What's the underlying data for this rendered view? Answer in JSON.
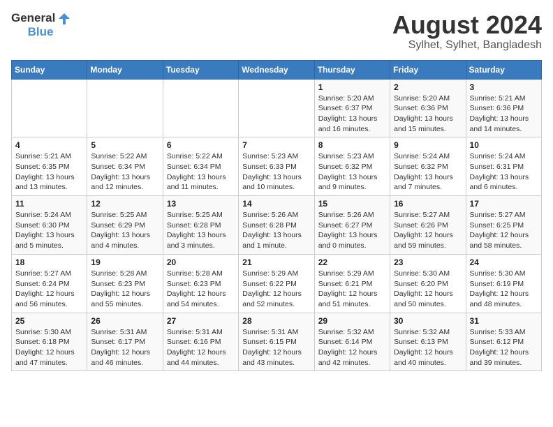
{
  "logo": {
    "line1": "General",
    "line2": "Blue"
  },
  "title": "August 2024",
  "subtitle": "Sylhet, Sylhet, Bangladesh",
  "days_of_week": [
    "Sunday",
    "Monday",
    "Tuesday",
    "Wednesday",
    "Thursday",
    "Friday",
    "Saturday"
  ],
  "weeks": [
    [
      {
        "day": "",
        "info": ""
      },
      {
        "day": "",
        "info": ""
      },
      {
        "day": "",
        "info": ""
      },
      {
        "day": "",
        "info": ""
      },
      {
        "day": "1",
        "info": "Sunrise: 5:20 AM\nSunset: 6:37 PM\nDaylight: 13 hours\nand 16 minutes."
      },
      {
        "day": "2",
        "info": "Sunrise: 5:20 AM\nSunset: 6:36 PM\nDaylight: 13 hours\nand 15 minutes."
      },
      {
        "day": "3",
        "info": "Sunrise: 5:21 AM\nSunset: 6:36 PM\nDaylight: 13 hours\nand 14 minutes."
      }
    ],
    [
      {
        "day": "4",
        "info": "Sunrise: 5:21 AM\nSunset: 6:35 PM\nDaylight: 13 hours\nand 13 minutes."
      },
      {
        "day": "5",
        "info": "Sunrise: 5:22 AM\nSunset: 6:34 PM\nDaylight: 13 hours\nand 12 minutes."
      },
      {
        "day": "6",
        "info": "Sunrise: 5:22 AM\nSunset: 6:34 PM\nDaylight: 13 hours\nand 11 minutes."
      },
      {
        "day": "7",
        "info": "Sunrise: 5:23 AM\nSunset: 6:33 PM\nDaylight: 13 hours\nand 10 minutes."
      },
      {
        "day": "8",
        "info": "Sunrise: 5:23 AM\nSunset: 6:32 PM\nDaylight: 13 hours\nand 9 minutes."
      },
      {
        "day": "9",
        "info": "Sunrise: 5:24 AM\nSunset: 6:32 PM\nDaylight: 13 hours\nand 7 minutes."
      },
      {
        "day": "10",
        "info": "Sunrise: 5:24 AM\nSunset: 6:31 PM\nDaylight: 13 hours\nand 6 minutes."
      }
    ],
    [
      {
        "day": "11",
        "info": "Sunrise: 5:24 AM\nSunset: 6:30 PM\nDaylight: 13 hours\nand 5 minutes."
      },
      {
        "day": "12",
        "info": "Sunrise: 5:25 AM\nSunset: 6:29 PM\nDaylight: 13 hours\nand 4 minutes."
      },
      {
        "day": "13",
        "info": "Sunrise: 5:25 AM\nSunset: 6:28 PM\nDaylight: 13 hours\nand 3 minutes."
      },
      {
        "day": "14",
        "info": "Sunrise: 5:26 AM\nSunset: 6:28 PM\nDaylight: 13 hours\nand 1 minute."
      },
      {
        "day": "15",
        "info": "Sunrise: 5:26 AM\nSunset: 6:27 PM\nDaylight: 13 hours\nand 0 minutes."
      },
      {
        "day": "16",
        "info": "Sunrise: 5:27 AM\nSunset: 6:26 PM\nDaylight: 12 hours\nand 59 minutes."
      },
      {
        "day": "17",
        "info": "Sunrise: 5:27 AM\nSunset: 6:25 PM\nDaylight: 12 hours\nand 58 minutes."
      }
    ],
    [
      {
        "day": "18",
        "info": "Sunrise: 5:27 AM\nSunset: 6:24 PM\nDaylight: 12 hours\nand 56 minutes."
      },
      {
        "day": "19",
        "info": "Sunrise: 5:28 AM\nSunset: 6:23 PM\nDaylight: 12 hours\nand 55 minutes."
      },
      {
        "day": "20",
        "info": "Sunrise: 5:28 AM\nSunset: 6:23 PM\nDaylight: 12 hours\nand 54 minutes."
      },
      {
        "day": "21",
        "info": "Sunrise: 5:29 AM\nSunset: 6:22 PM\nDaylight: 12 hours\nand 52 minutes."
      },
      {
        "day": "22",
        "info": "Sunrise: 5:29 AM\nSunset: 6:21 PM\nDaylight: 12 hours\nand 51 minutes."
      },
      {
        "day": "23",
        "info": "Sunrise: 5:30 AM\nSunset: 6:20 PM\nDaylight: 12 hours\nand 50 minutes."
      },
      {
        "day": "24",
        "info": "Sunrise: 5:30 AM\nSunset: 6:19 PM\nDaylight: 12 hours\nand 48 minutes."
      }
    ],
    [
      {
        "day": "25",
        "info": "Sunrise: 5:30 AM\nSunset: 6:18 PM\nDaylight: 12 hours\nand 47 minutes."
      },
      {
        "day": "26",
        "info": "Sunrise: 5:31 AM\nSunset: 6:17 PM\nDaylight: 12 hours\nand 46 minutes."
      },
      {
        "day": "27",
        "info": "Sunrise: 5:31 AM\nSunset: 6:16 PM\nDaylight: 12 hours\nand 44 minutes."
      },
      {
        "day": "28",
        "info": "Sunrise: 5:31 AM\nSunset: 6:15 PM\nDaylight: 12 hours\nand 43 minutes."
      },
      {
        "day": "29",
        "info": "Sunrise: 5:32 AM\nSunset: 6:14 PM\nDaylight: 12 hours\nand 42 minutes."
      },
      {
        "day": "30",
        "info": "Sunrise: 5:32 AM\nSunset: 6:13 PM\nDaylight: 12 hours\nand 40 minutes."
      },
      {
        "day": "31",
        "info": "Sunrise: 5:33 AM\nSunset: 6:12 PM\nDaylight: 12 hours\nand 39 minutes."
      }
    ]
  ]
}
